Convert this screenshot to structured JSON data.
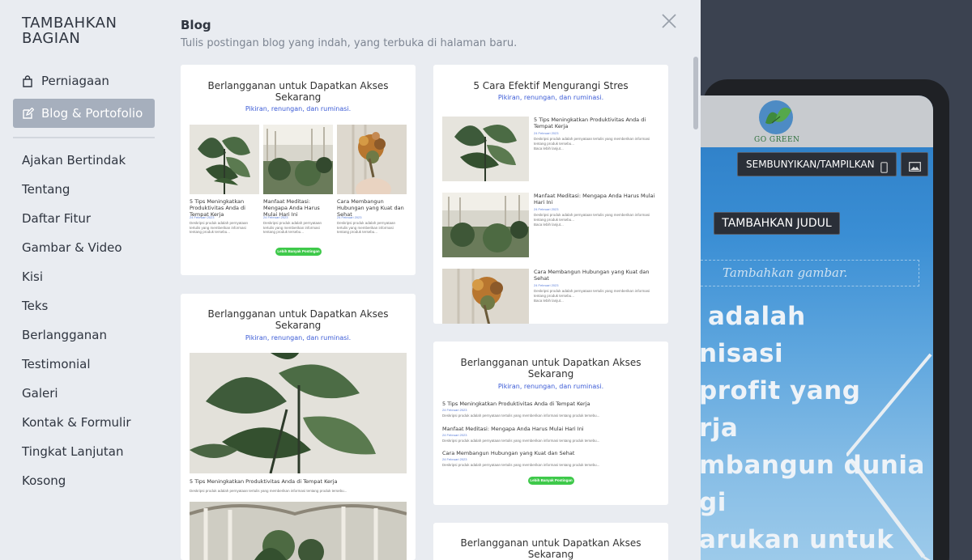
{
  "sidebar": {
    "title": "TAMBAHKAN BAGIAN",
    "top_items": [
      {
        "label": "Perniagaan",
        "icon": "shopping-bag-icon"
      },
      {
        "label": "Blog & Portofolio",
        "icon": "edit-icon"
      }
    ],
    "items": [
      "Ajakan Bertindak",
      "Tentang",
      "Daftar Fitur",
      "Gambar & Video",
      "Kisi",
      "Teks",
      "Berlangganan",
      "Testimonial",
      "Galeri",
      "Kontak & Formulir",
      "Tingkat Lanjutan",
      "Kosong"
    ]
  },
  "gallery": {
    "heading": "Blog",
    "subtitle": "Tulis postingan blog yang indah, yang terbuka di halaman baru.",
    "close_icon": "close-icon",
    "card1": {
      "title": "Berlangganan untuk Dapatkan Akses Sekarang",
      "tagline": "Pikiran, renungan, dan ruminasi.",
      "posts": [
        {
          "title": "5 Tips Meningkatkan Produktivitas Anda di Tempat Kerja",
          "date": "24 Februari 2023",
          "desc": "Deskripsi produk adalah pernyataan tertulis yang memberikan informasi tentang produk tersebu..."
        },
        {
          "title": "Manfaat Meditasi: Mengapa Anda Harus Mulai Hari Ini",
          "date": "24 Februari 2023",
          "desc": "Deskripsi produk adalah pernyataan tertulis yang memberikan informasi tentang produk tersebu..."
        },
        {
          "title": "Cara Membangun Hubungan yang Kuat dan Sehat",
          "date": "24 Februari 2023",
          "desc": "Deskripsi produk adalah pernyataan tertulis yang memberikan informasi tentang produk tersebu..."
        }
      ],
      "button": "Lebih Banyak Postingan"
    },
    "card2": {
      "title": "5 Cara Efektif Mengurangi Stres",
      "tagline": "Pikiran, renungan, dan ruminasi.",
      "posts": [
        {
          "title": "5 Tips Meningkatkan Produktivitas Anda di Tempat Kerja",
          "date": "24 Februari 2023",
          "desc": "Deskripsi produk adalah pernyataan tertulis yang memberikan informasi tentang produk tersebu...",
          "more": "Baca lebih lanjut..."
        },
        {
          "title": "Manfaat Meditasi: Mengapa Anda Harus Mulai Hari Ini",
          "date": "24 Februari 2023",
          "desc": "Deskripsi produk adalah pernyataan tertulis yang memberikan informasi tentang produk tersebu...",
          "more": "Baca lebih lanjut..."
        },
        {
          "title": "Cara Membangun Hubungan yang Kuat dan Sehat",
          "date": "24 Februari 2023",
          "desc": "Deskripsi produk adalah pernyataan tertulis yang memberikan informasi tentang produk tersebu...",
          "more": "Baca lebih lanjut..."
        }
      ]
    },
    "card3": {
      "title": "Berlangganan untuk Dapatkan Akses Sekarang",
      "tagline": "Pikiran, renungan, dan ruminasi.",
      "post_title": "5 Tips Meningkatkan Produktivitas Anda di Tempat Kerja",
      "post_desc": "Deskripsi produk adalah pernyataan tertulis yang memberikan informasi tentang produk tersebu..."
    },
    "card4": {
      "title": "Berlangganan untuk Dapatkan Akses Sekarang",
      "tagline": "Pikiran, renungan, dan ruminasi.",
      "posts": [
        {
          "title": "5 Tips Meningkatkan Produktivitas Anda di Tempat Kerja",
          "date": "24 Februari 2023",
          "desc": "Deskripsi produk adalah pernyataan tertulis yang memberikan informasi tentang produk tersebu..."
        },
        {
          "title": "Manfaat Meditasi: Mengapa Anda Harus Mulai Hari Ini",
          "date": "24 Februari 2023",
          "desc": "Deskripsi produk adalah pernyataan tertulis yang memberikan informasi tentang produk tersebu..."
        },
        {
          "title": "Cara Membangun Hubungan yang Kuat dan Sehat",
          "date": "24 Februari 2023",
          "desc": "Deskripsi produk adalah pernyataan tertulis yang memberikan informasi tentang produk tersebu..."
        }
      ],
      "button": "Lebih Banyak Postingan"
    },
    "card5": {
      "title": "Berlangganan untuk Dapatkan Akses Sekarang"
    }
  },
  "preview": {
    "logo_text": "GO GREEN",
    "toggle_label": "SEMBUNYIKAN/TAMPILKAN",
    "toggle_icon": "mobile-icon",
    "image_icon": "image-icon",
    "add_title": "TAMBAHKAN JUDUL",
    "add_image": "Tambahkan gambar.",
    "hero_lines": [
      "adalah",
      "nisasi",
      "profit yang",
      "rja",
      "mbangun dunia",
      "gi",
      "arukan untuk"
    ]
  },
  "colors": {
    "sidebar_bg": "#e9ecf1",
    "active_item_bg": "#a6afbd",
    "link_blue": "#3b5bd6",
    "button_green": "#3ec94a",
    "preview_bg": "#3b4250"
  }
}
